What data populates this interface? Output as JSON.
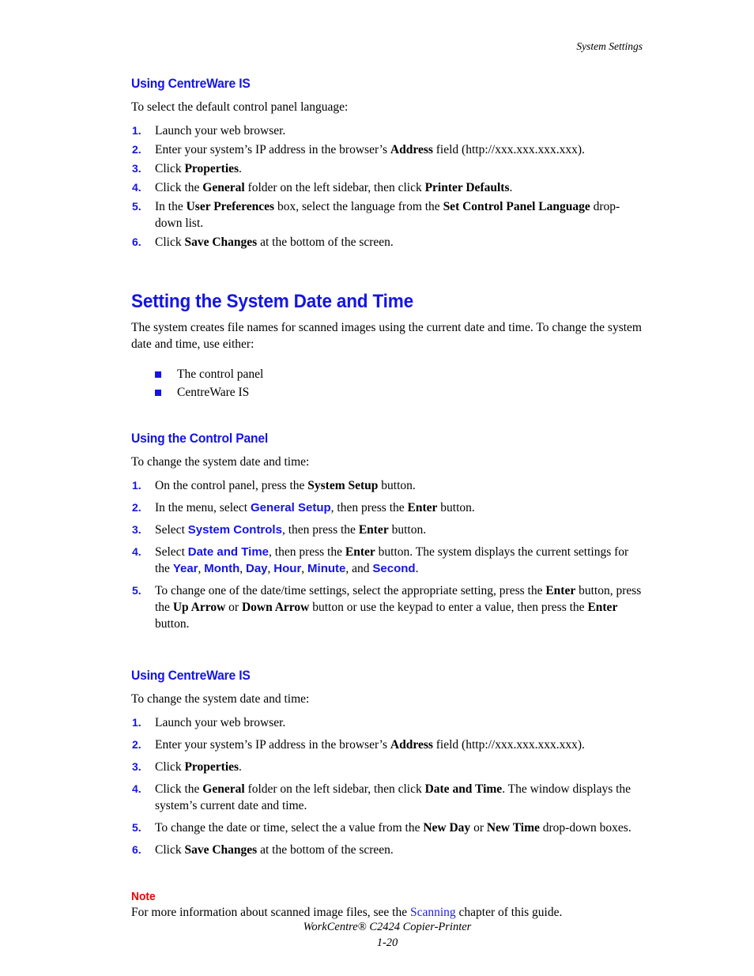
{
  "page": {
    "running_header": "System Settings",
    "footer_product": "WorkCentre® C2424 Copier-Printer",
    "footer_page_number": "1-20"
  },
  "colors": {
    "heading_blue": "#1414e6",
    "bullet_blue": "#1414e6",
    "note_red": "#ee0000",
    "xref_blue": "#2222dd",
    "body_black": "#000000"
  },
  "sections": {
    "centreware_language": {
      "heading": "Using CentreWare IS",
      "intro": "To select the default control panel language:",
      "steps": [
        {
          "number": "1.",
          "runs": [
            {
              "t": "Launch your web browser.",
              "s": "n"
            }
          ]
        },
        {
          "number": "2.",
          "runs": [
            {
              "t": "Enter your system’s IP address in the browser’s ",
              "s": "n"
            },
            {
              "t": "Address",
              "s": "b"
            },
            {
              "t": " field (http://xxx.xxx.xxx.xxx).",
              "s": "n"
            }
          ]
        },
        {
          "number": "3.",
          "runs": [
            {
              "t": "Click ",
              "s": "n"
            },
            {
              "t": "Properties",
              "s": "b"
            },
            {
              "t": ".",
              "s": "n"
            }
          ]
        },
        {
          "number": "4.",
          "runs": [
            {
              "t": "Click the ",
              "s": "n"
            },
            {
              "t": "General",
              "s": "b"
            },
            {
              "t": " folder on the left sidebar, then click ",
              "s": "n"
            },
            {
              "t": "Printer Defaults",
              "s": "b"
            },
            {
              "t": ".",
              "s": "n"
            }
          ]
        },
        {
          "number": "5.",
          "runs": [
            {
              "t": "In the ",
              "s": "n"
            },
            {
              "t": "User Preferences",
              "s": "b"
            },
            {
              "t": " box, select the language from the ",
              "s": "n"
            },
            {
              "t": "Set Control Panel Language",
              "s": "b"
            },
            {
              "t": " drop-down list.",
              "s": "n"
            }
          ]
        },
        {
          "number": "6.",
          "runs": [
            {
              "t": "Click ",
              "s": "n"
            },
            {
              "t": "Save Changes",
              "s": "b"
            },
            {
              "t": " at the bottom of the screen.",
              "s": "n"
            }
          ]
        }
      ]
    },
    "date_and_time": {
      "heading": "Setting the System Date and Time",
      "intro": "The system creates file names for scanned images using the current date and time. To change the system date and time, use either:",
      "bullets": [
        "The control panel",
        "CentreWare IS"
      ]
    },
    "control_panel": {
      "heading": "Using the Control Panel",
      "intro": "To change the system date and time:",
      "steps": [
        {
          "number": "1.",
          "runs": [
            {
              "t": "On the control panel, press the ",
              "s": "n"
            },
            {
              "t": "System Setup",
              "s": "b"
            },
            {
              "t": " button.",
              "s": "n"
            }
          ]
        },
        {
          "number": "2.",
          "runs": [
            {
              "t": "In the menu, select ",
              "s": "n"
            },
            {
              "t": "General Setup",
              "s": "cp"
            },
            {
              "t": ", then press the ",
              "s": "n"
            },
            {
              "t": "Enter",
              "s": "b"
            },
            {
              "t": " button.",
              "s": "n"
            }
          ]
        },
        {
          "number": "3.",
          "runs": [
            {
              "t": "Select ",
              "s": "n"
            },
            {
              "t": "System Controls",
              "s": "cp"
            },
            {
              "t": ", then press the ",
              "s": "n"
            },
            {
              "t": "Enter",
              "s": "b"
            },
            {
              "t": " button.",
              "s": "n"
            }
          ]
        },
        {
          "number": "4.",
          "runs": [
            {
              "t": "Select ",
              "s": "n"
            },
            {
              "t": "Date and Time",
              "s": "cp"
            },
            {
              "t": ", then press the ",
              "s": "n"
            },
            {
              "t": "Enter",
              "s": "b"
            },
            {
              "t": " button. The system displays the current settings for the ",
              "s": "n"
            },
            {
              "t": "Year",
              "s": "cp"
            },
            {
              "t": ", ",
              "s": "n"
            },
            {
              "t": "Month",
              "s": "cp"
            },
            {
              "t": ", ",
              "s": "n"
            },
            {
              "t": "Day",
              "s": "cp"
            },
            {
              "t": ", ",
              "s": "n"
            },
            {
              "t": "Hour",
              "s": "cp"
            },
            {
              "t": ", ",
              "s": "n"
            },
            {
              "t": "Minute",
              "s": "cp"
            },
            {
              "t": ", and ",
              "s": "n"
            },
            {
              "t": "Second",
              "s": "cp"
            },
            {
              "t": ".",
              "s": "n"
            }
          ]
        },
        {
          "number": "5.",
          "runs": [
            {
              "t": "To change one of the date/time settings, select the appropriate setting, press the ",
              "s": "n"
            },
            {
              "t": "Enter",
              "s": "b"
            },
            {
              "t": " button, press the ",
              "s": "n"
            },
            {
              "t": "Up Arrow",
              "s": "b"
            },
            {
              "t": " or ",
              "s": "n"
            },
            {
              "t": "Down Arrow",
              "s": "b"
            },
            {
              "t": " button or use the keypad to enter a value, then press the ",
              "s": "n"
            },
            {
              "t": "Enter",
              "s": "b"
            },
            {
              "t": " button.",
              "s": "n"
            }
          ]
        }
      ]
    },
    "centreware_datetime": {
      "heading": "Using CentreWare IS",
      "intro": "To change the system date and time:",
      "steps": [
        {
          "number": "1.",
          "runs": [
            {
              "t": "Launch your web browser.",
              "s": "n"
            }
          ]
        },
        {
          "number": "2.",
          "runs": [
            {
              "t": "Enter your system’s IP address in the browser’s ",
              "s": "n"
            },
            {
              "t": "Address",
              "s": "b"
            },
            {
              "t": " field (http://xxx.xxx.xxx.xxx).",
              "s": "n"
            }
          ]
        },
        {
          "number": "3.",
          "runs": [
            {
              "t": "Click ",
              "s": "n"
            },
            {
              "t": "Properties",
              "s": "b"
            },
            {
              "t": ".",
              "s": "n"
            }
          ]
        },
        {
          "number": "4.",
          "runs": [
            {
              "t": "Click the ",
              "s": "n"
            },
            {
              "t": "General",
              "s": "b"
            },
            {
              "t": " folder on the left sidebar, then click ",
              "s": "n"
            },
            {
              "t": "Date and Time",
              "s": "b"
            },
            {
              "t": ". The window displays the system’s current date and time.",
              "s": "n"
            }
          ]
        },
        {
          "number": "5.",
          "runs": [
            {
              "t": "To change the date or time, select the a value from the ",
              "s": "n"
            },
            {
              "t": "New Day",
              "s": "b"
            },
            {
              "t": " or ",
              "s": "n"
            },
            {
              "t": "New Time",
              "s": "b"
            },
            {
              "t": " drop-down boxes.",
              "s": "n"
            }
          ]
        },
        {
          "number": "6.",
          "runs": [
            {
              "t": "Click ",
              "s": "n"
            },
            {
              "t": "Save Changes",
              "s": "b"
            },
            {
              "t": " at the bottom of the screen.",
              "s": "n"
            }
          ]
        }
      ]
    },
    "note": {
      "label": "Note",
      "runs": [
        {
          "t": "For more information about scanned image files, see the ",
          "s": "n"
        },
        {
          "t": "Scanning",
          "s": "x"
        },
        {
          "t": " chapter of this guide.",
          "s": "n"
        }
      ]
    }
  }
}
